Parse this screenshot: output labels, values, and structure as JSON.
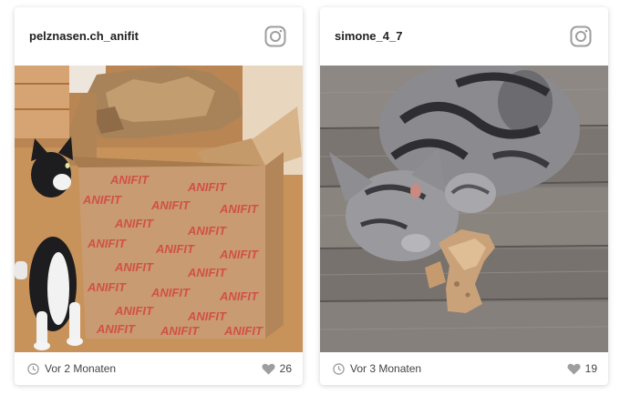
{
  "posts": [
    {
      "username": "pelznasen.ch_anifit",
      "time": "Vor 2 Monaten",
      "likes": "26",
      "image": "black-and-white kitten looking into a cardboard box",
      "box_print": [
        "ANIFIT",
        "ANIFIT",
        "ANIFIT",
        "ANIFIT",
        "ANIFIT",
        "ANIFIT",
        "ANIFIT",
        "ANIFIT",
        "ANIFIT",
        "ANIFIT",
        "ANIFIT",
        "ANIFIT",
        "ANIFIT",
        "ANIFIT",
        "ANIFIT",
        "ANIFIT",
        "ANIFIT",
        "ANIFIT",
        "ANIFIT",
        "ANIFIT",
        "ANIFIT",
        "ANIFIT",
        "ANIFIT",
        "ANIFIT"
      ]
    },
    {
      "username": "simone_4_7",
      "time": "Vor 3 Monaten",
      "likes": "19",
      "image": "grey tabby cat eating a treat on a wooden deck"
    }
  ],
  "colors": {
    "text": "#222222",
    "muted": "#444444",
    "icon": "#9e9e9e",
    "box": "#c99b72",
    "print": "#d2453f"
  },
  "icons": [
    "instagram-icon",
    "clock-icon",
    "heart-icon"
  ]
}
